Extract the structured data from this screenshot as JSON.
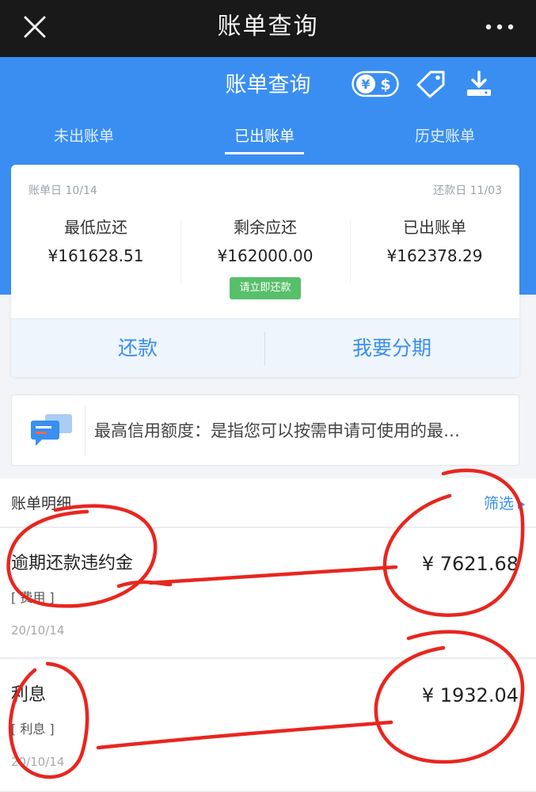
{
  "topbar": {
    "title": "账单查询",
    "close_icon": "close-icon",
    "more_icon": "more-icon"
  },
  "header": {
    "title": "账单查询",
    "tabs": [
      {
        "label": "未出账单",
        "active": false
      },
      {
        "label": "已出账单",
        "active": true
      },
      {
        "label": "历史账单",
        "active": false
      }
    ]
  },
  "summary": {
    "bill_date": "账单日 10/14",
    "due_date": "还款日 11/03",
    "columns": [
      {
        "label": "最低应还",
        "value": "¥161628.51"
      },
      {
        "label": "剩余应还",
        "value": "¥162000.00"
      },
      {
        "label": "已出账单",
        "value": "¥162378.29"
      }
    ],
    "pay_now_badge": "请立即还款",
    "repay_button": "还款",
    "installment_button": "我要分期"
  },
  "notice": {
    "text": "最高信用额度：是指您可以按需申请可使用的最…"
  },
  "details": {
    "title": "账单明细",
    "filter_label": "筛选",
    "items": [
      {
        "name": "逾期还款违约金",
        "tag": "[ 费用 ]",
        "date": "20/10/14",
        "amount": "¥ 7621.68"
      },
      {
        "name": "利息",
        "tag": "[ 利息 ]",
        "date": "20/10/14",
        "amount": "¥ 1932.04"
      }
    ]
  },
  "colors": {
    "brand_blue": "#3a8ef2",
    "badge_green": "#58bf6a",
    "top_bar": "#191919",
    "annotation_red": "#e8261f"
  }
}
